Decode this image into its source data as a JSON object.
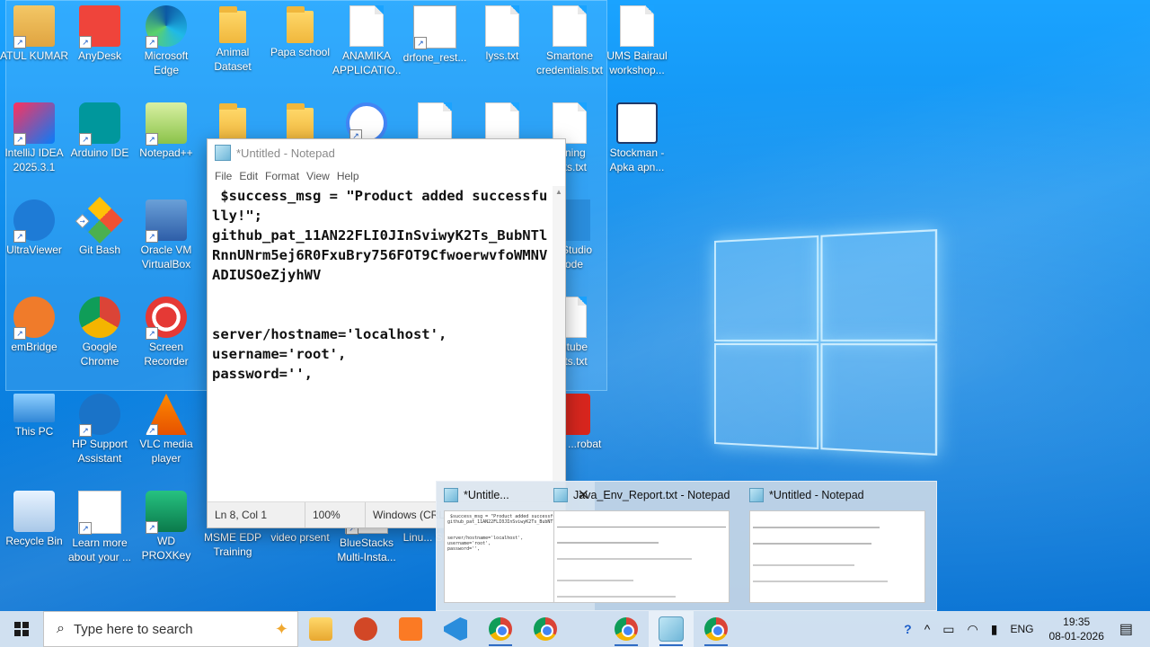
{
  "desktop": {
    "icons": [
      {
        "label": "ATUL KUMAR",
        "kind": "person"
      },
      {
        "label": "AnyDesk",
        "kind": "anydesk"
      },
      {
        "label": "Microsoft Edge",
        "kind": "edge"
      },
      {
        "label": "Animal Dataset",
        "kind": "folder"
      },
      {
        "label": "Papa school",
        "kind": "folder"
      },
      {
        "label": "ANAMIKA APPLICATIO...",
        "kind": "file"
      },
      {
        "label": "drfone_rest...",
        "kind": "app"
      },
      {
        "label": "lyss.txt",
        "kind": "file"
      },
      {
        "label": "Smartone credentials.txt",
        "kind": "file"
      },
      {
        "label": "UMS Bairaul workshop...",
        "kind": "file"
      },
      {
        "label": "IntelliJ IDEA 2025.3.1",
        "kind": "intellij"
      },
      {
        "label": "Arduino IDE",
        "kind": "arduino"
      },
      {
        "label": "Notepad++",
        "kind": "notepadpp"
      },
      {
        "label": "",
        "kind": "folder"
      },
      {
        "label": "",
        "kind": "folder"
      },
      {
        "label": "",
        "kind": "androidstudio"
      },
      {
        "label": "",
        "kind": "file"
      },
      {
        "label": "",
        "kind": "file"
      },
      {
        "label": "...ining ...ks.txt",
        "kind": "file"
      },
      {
        "label": "Stockman - Apka apn...",
        "kind": "stockman"
      },
      {
        "label": "UltraViewer",
        "kind": "ultraviewer"
      },
      {
        "label": "Git Bash",
        "kind": "gitbash"
      },
      {
        "label": "Oracle VM VirtualBox",
        "kind": "virtualbox"
      },
      {
        "label": "...l Studio ...ode",
        "kind": "vscode"
      },
      {
        "label": "emBridge",
        "kind": "embridge"
      },
      {
        "label": "Google Chrome",
        "kind": "chrome"
      },
      {
        "label": "Screen Recorder",
        "kind": "recorder"
      },
      {
        "label": "...utube ...rts.txt",
        "kind": "file"
      },
      {
        "label": "This PC",
        "kind": "pc"
      },
      {
        "label": "HP Support Assistant",
        "kind": "hp"
      },
      {
        "label": "VLC media player",
        "kind": "vlc"
      },
      {
        "label": "...obe ...robat",
        "kind": "acrobat"
      },
      {
        "label": "Recycle Bin",
        "kind": "recycle"
      },
      {
        "label": "Learn more about your ...",
        "kind": "chromefile"
      },
      {
        "label": "WD PROXKey",
        "kind": "wd"
      },
      {
        "label": "MSME EDP Training",
        "kind": "folder"
      },
      {
        "label": "video prsent",
        "kind": "folder"
      },
      {
        "label": "BlueStacks Multi-Insta...",
        "kind": "bluestacks"
      },
      {
        "label": "Linu... Shor...",
        "kind": "folder"
      }
    ]
  },
  "notepad": {
    "title": "*Untitled - Notepad",
    "menu": [
      "File",
      "Edit",
      "Format",
      "View",
      "Help"
    ],
    "content": " $success_msg = \"Product added successfully!\";\n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\n\n\nserver/hostname='localhost',\nusername='root',\npassword='',",
    "status": {
      "position": "Ln 8, Col 1",
      "zoom": "100%",
      "encoding": "Windows (CRLF)"
    }
  },
  "preview": {
    "thumbs": [
      {
        "title": "*Untitle...",
        "snippet": " $success_msg = \"Product added successfully!\";\n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\n\n\nserver/hostname='localhost',\nusername='root',\npassword='',",
        "active": true
      },
      {
        "title": "Java_Env_Report.txt - Notepad",
        "snippet": "",
        "active": false
      },
      {
        "title": "*Untitled - Notepad",
        "snippet": "",
        "active": false
      }
    ]
  },
  "taskbar": {
    "search_placeholder": "Type here to search",
    "language": "ENG",
    "time": "19:35",
    "date": "08-01-2026"
  }
}
